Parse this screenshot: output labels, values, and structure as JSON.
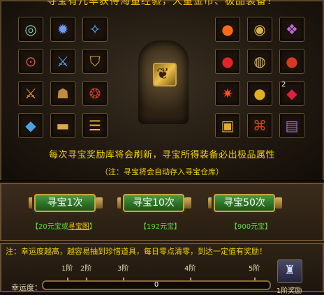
{
  "banner": "寻宝有几率获得海量经验，大量金币、极品装备！",
  "left_grid": [
    {
      "icon": "ring-icon",
      "glyph": "◎",
      "color": "#7fc8a8"
    },
    {
      "icon": "amulet-icon",
      "glyph": "✹",
      "color": "#6f9bff"
    },
    {
      "icon": "crystal-wings-icon",
      "glyph": "✧",
      "color": "#62b6ff"
    },
    {
      "icon": "bracelet-icon",
      "glyph": "⊙",
      "color": "#d2553a"
    },
    {
      "icon": "sword-icon",
      "glyph": "⚔",
      "color": "#5da6ff"
    },
    {
      "icon": "shield-icon",
      "glyph": "⛉",
      "color": "#d7a24a"
    },
    {
      "icon": "dagger-icon",
      "glyph": "⚔",
      "color": "#e0a030"
    },
    {
      "icon": "helmet-icon",
      "glyph": "☗",
      "color": "#c08a40"
    },
    {
      "icon": "necklace-icon",
      "glyph": "❂",
      "color": "#c0392b"
    },
    {
      "icon": "blue-gem-icon",
      "glyph": "◆",
      "color": "#4aa3e8"
    },
    {
      "icon": "gold-bar-icon",
      "glyph": "▬",
      "color": "#d8a94a"
    },
    {
      "icon": "gold-ingot-icon",
      "glyph": "☰",
      "color": "#e6b840"
    }
  ],
  "right_grid": [
    {
      "icon": "fire-orb-icon",
      "glyph": "●",
      "color": "#ff6a1a",
      "count": ""
    },
    {
      "icon": "gold-ring-icon",
      "glyph": "◉",
      "color": "#d9b042",
      "count": ""
    },
    {
      "icon": "purple-gem-icon",
      "glyph": "❖",
      "color": "#c06ad6",
      "count": ""
    },
    {
      "icon": "red-orb-icon",
      "glyph": "●",
      "color": "#e0262a",
      "count": ""
    },
    {
      "icon": "gold-orb-icon",
      "glyph": "◍",
      "color": "#d8b25a",
      "count": ""
    },
    {
      "icon": "apple-icon",
      "glyph": "●",
      "color": "#d63a1e",
      "count": ""
    },
    {
      "icon": "flame-icon",
      "glyph": "✷",
      "color": "#ff5020",
      "count": ""
    },
    {
      "icon": "gold-ball-icon",
      "glyph": "●",
      "color": "#e0b020",
      "count": ""
    },
    {
      "icon": "ruby-icon",
      "glyph": "◆",
      "color": "#e02040",
      "count": "2"
    },
    {
      "icon": "treasure-chest-icon",
      "glyph": "▣",
      "color": "#e0b020",
      "count": ""
    },
    {
      "icon": "scroll-icon",
      "glyph": "⌘",
      "color": "#c44a20",
      "count": ""
    },
    {
      "icon": "book-icon",
      "glyph": "▤",
      "color": "#9a6ad8",
      "count": ""
    }
  ],
  "info_line": "每次寻宝奖励库将会刷新，寻宝所得装备必出极品属性",
  "info_note": "（注：寻宝将会自动存入寻宝仓库）",
  "buttons": [
    {
      "label": "寻宝1次",
      "price_prefix": "【20元宝或",
      "price_link": "寻宝图",
      "price_suffix": "】"
    },
    {
      "label": "寻宝10次",
      "price": "【192元宝】"
    },
    {
      "label": "寻宝50次",
      "price": "【900元宝】"
    }
  ],
  "luck": {
    "note": "注：幸运度越高，越容易抽到珍惜道具，每日零点清零，到达一定值有奖励！",
    "label": "幸运度：",
    "value": "0",
    "stages": [
      "1阶",
      "2阶",
      "3阶",
      "4阶",
      "5阶"
    ],
    "reward_label": "1阶奖励"
  }
}
